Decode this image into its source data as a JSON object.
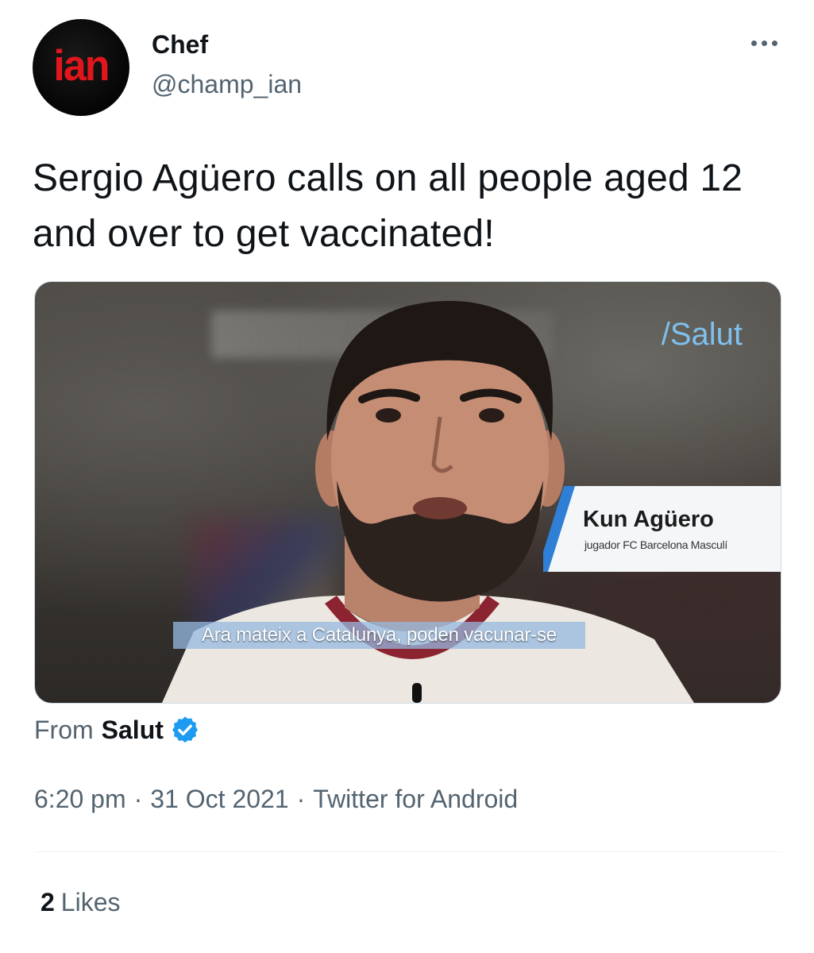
{
  "author": {
    "avatar_text": "ian",
    "display_name": "Chef",
    "handle": "@champ_ian"
  },
  "icons": {
    "more": "more-horizontal-icon",
    "verified": "verified-badge-icon"
  },
  "tweet": {
    "text": "Sergio Agüero calls on all people aged 12 and over to get vaccinated!"
  },
  "media": {
    "channel_tag": "/Salut",
    "lower_third": {
      "name": "Kun Agüero",
      "role": "jugador FC Barcelona Masculí"
    },
    "subtitle": "Ara mateix a Catalunya, poden vacunar-se"
  },
  "source": {
    "prefix": "From",
    "name": "Salut"
  },
  "meta": {
    "time": "6:20 pm",
    "separator": "·",
    "date": "31 Oct 2021",
    "client": "Twitter for Android"
  },
  "engagement": {
    "likes_count": "2",
    "likes_label": "Likes"
  },
  "colors": {
    "text_primary": "#0f1419",
    "text_secondary": "#536471",
    "verified_blue": "#1d9bf0",
    "avatar_red": "#e0161c"
  }
}
